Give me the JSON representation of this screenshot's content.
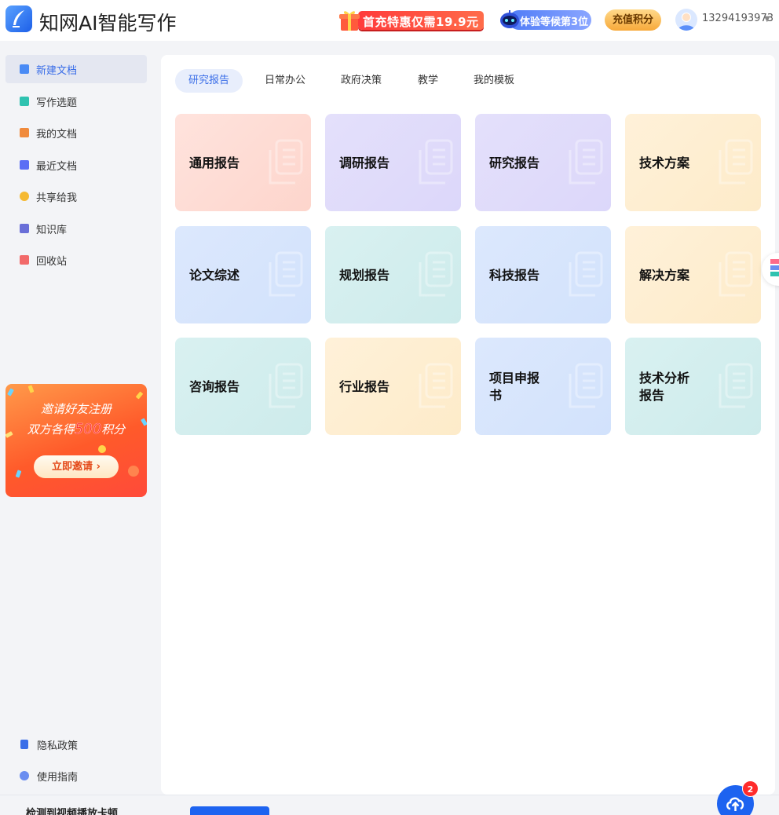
{
  "header": {
    "app_title": "知网AI智能写作",
    "promo_text": "首充特惠仅需19.9元",
    "rank_text": "体验等候第3位",
    "recharge_label": "充值积分",
    "username": "13294193973"
  },
  "sidebar": {
    "items": [
      {
        "label": "新建文档",
        "icon": "new-doc-icon",
        "color": "#4a8bf5"
      },
      {
        "label": "写作选题",
        "icon": "topic-icon",
        "color": "#2fc2b0"
      },
      {
        "label": "我的文档",
        "icon": "my-doc-icon",
        "color": "#f08a3c"
      },
      {
        "label": "最近文档",
        "icon": "recent-doc-icon",
        "color": "#5b6ef5"
      },
      {
        "label": "共享给我",
        "icon": "share-icon",
        "color": "#f5b932"
      },
      {
        "label": "知识库",
        "icon": "knowledge-icon",
        "color": "#6a6fd8"
      },
      {
        "label": "回收站",
        "icon": "trash-icon",
        "color": "#f26a6a"
      }
    ],
    "invite": {
      "line1": "邀请好友注册",
      "line2_prefix": "双方各得",
      "line2_number": "500",
      "line2_suffix": "积分",
      "button": "立即邀请 ›"
    },
    "bottom_items": [
      {
        "label": "隐私政策",
        "icon": "privacy-icon",
        "color": "#3a6ee8"
      },
      {
        "label": "使用指南",
        "icon": "guide-icon",
        "color": "#3a6ee8"
      }
    ]
  },
  "main": {
    "tabs": [
      "研究报告",
      "日常办公",
      "政府决策",
      "教学",
      "我的模板"
    ],
    "active_tab": 0,
    "cards": [
      {
        "title": "通用报告",
        "color": "pink"
      },
      {
        "title": "调研报告",
        "color": "purple"
      },
      {
        "title": "研究报告",
        "color": "purple"
      },
      {
        "title": "技术方案",
        "color": "yellow"
      },
      {
        "title": "论文综述",
        "color": "blue"
      },
      {
        "title": "规划报告",
        "color": "teal"
      },
      {
        "title": "科技报告",
        "color": "blue"
      },
      {
        "title": "解决方案",
        "color": "yellow"
      },
      {
        "title": "咨询报告",
        "color": "teal"
      },
      {
        "title": "行业报告",
        "color": "yellow"
      },
      {
        "title": "项目申报书",
        "color": "blue"
      },
      {
        "title": "技术分析报告",
        "color": "teal"
      }
    ]
  },
  "bottom_bar": {
    "message": "检测到视频播放卡顿",
    "badge_count": "2"
  }
}
